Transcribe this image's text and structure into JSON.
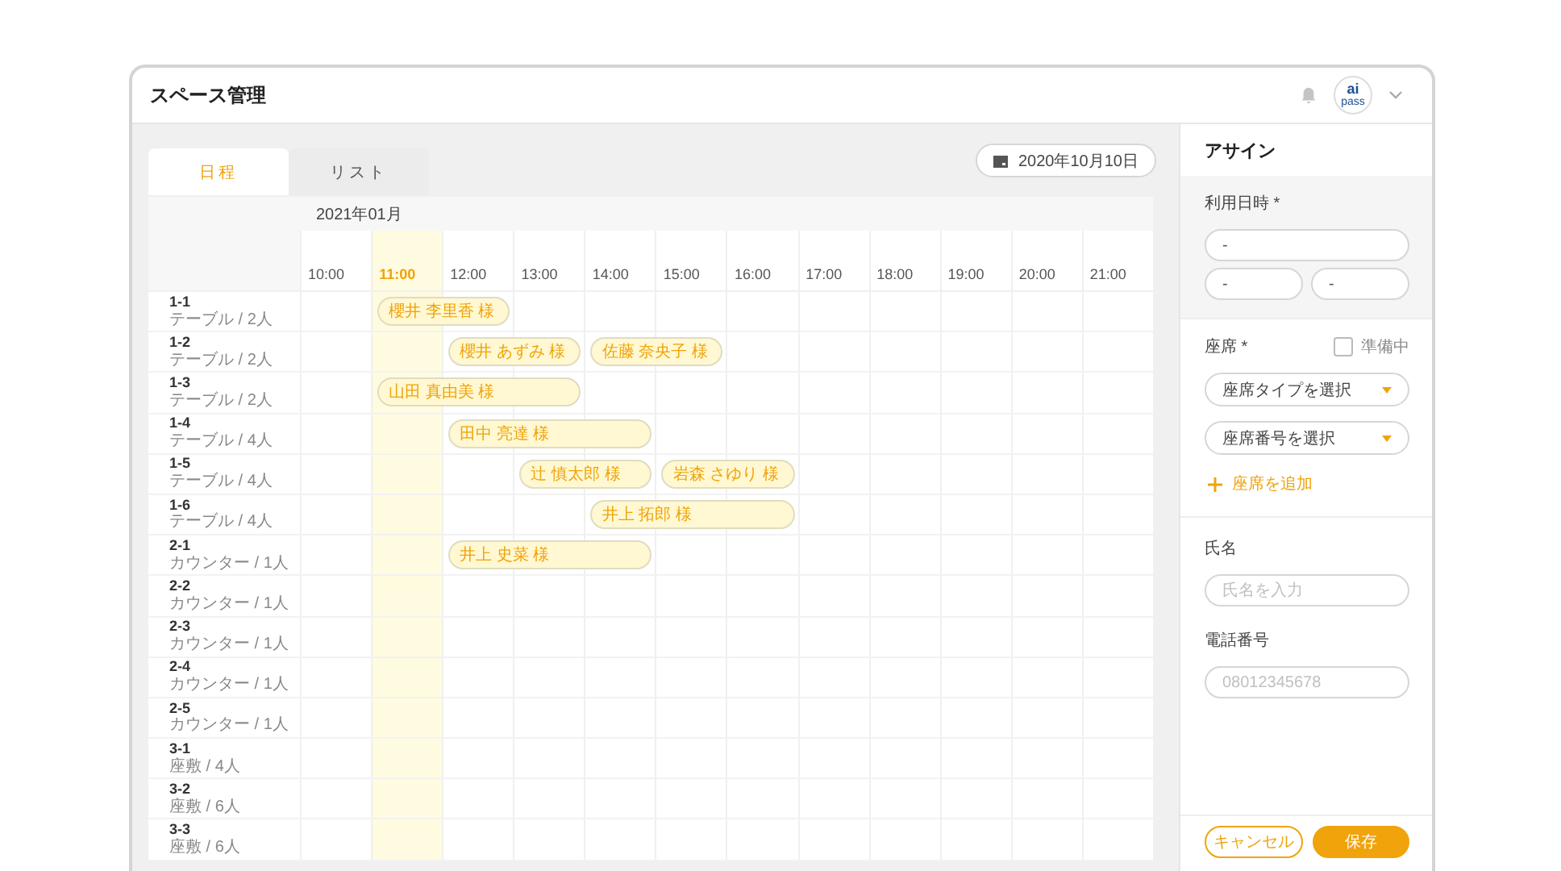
{
  "header": {
    "title": "スペース管理",
    "logo": {
      "text": "ai",
      "subtext": "pass"
    }
  },
  "tabs": [
    {
      "label": "日程",
      "selected": true
    },
    {
      "label": "リスト",
      "selected": false
    }
  ],
  "date_button": "2020年10月10日",
  "schedule": {
    "month": "2021年01月",
    "hours": [
      {
        "label": "10:00",
        "selected": false
      },
      {
        "label": "11:00",
        "selected": true
      },
      {
        "label": "12:00",
        "selected": false
      },
      {
        "label": "13:00",
        "selected": false
      },
      {
        "label": "14:00",
        "selected": false
      },
      {
        "label": "15:00",
        "selected": false
      },
      {
        "label": "16:00",
        "selected": false
      },
      {
        "label": "17:00",
        "selected": false
      },
      {
        "label": "18:00",
        "selected": false
      },
      {
        "label": "19:00",
        "selected": false
      },
      {
        "label": "20:00",
        "selected": false
      },
      {
        "label": "21:00",
        "selected": false
      }
    ],
    "rows": [
      {
        "seat": "1-1",
        "detail": "テーブル / 2人",
        "slots": [
          {
            "kind": "free"
          },
          {
            "kind": "start",
            "name": "櫻井 李里香 様"
          },
          {
            "kind": "continue"
          }
        ]
      },
      {
        "seat": "1-2",
        "detail": "テーブル / 2人",
        "slots": [
          {
            "kind": "free"
          },
          {
            "kind": "free"
          },
          {
            "kind": "start",
            "name": "櫻井 あずみ 様"
          },
          {
            "kind": "continue"
          },
          {
            "kind": "start",
            "name": "佐藤 奈央子 様"
          },
          {
            "kind": "continue"
          }
        ]
      },
      {
        "seat": "1-3",
        "detail": "テーブル / 2人",
        "slots": [
          {
            "kind": "free"
          },
          {
            "kind": "start",
            "name": "山田 真由美 様"
          },
          {
            "kind": "continue"
          },
          {
            "kind": "continue"
          }
        ]
      },
      {
        "seat": "1-4",
        "detail": "テーブル / 4人",
        "slots": [
          {
            "kind": "free"
          },
          {
            "kind": "free"
          },
          {
            "kind": "start",
            "name": "田中 亮達 様"
          },
          {
            "kind": "continue"
          },
          {
            "kind": "continue"
          }
        ]
      },
      {
        "seat": "1-5",
        "detail": "テーブル / 4人",
        "slots": [
          {
            "kind": "free"
          },
          {
            "kind": "free"
          },
          {
            "kind": "free"
          },
          {
            "kind": "start",
            "name": "辻 慎太郎 様"
          },
          {
            "kind": "continue"
          },
          {
            "kind": "start",
            "name": "岩森 さゆり 様"
          },
          {
            "kind": "continue"
          }
        ]
      },
      {
        "seat": "1-6",
        "detail": "テーブル / 4人",
        "slots": [
          {
            "kind": "free"
          },
          {
            "kind": "free"
          },
          {
            "kind": "free"
          },
          {
            "kind": "free"
          },
          {
            "kind": "start",
            "name": "井上 拓郎 様"
          },
          {
            "kind": "continue"
          },
          {
            "kind": "continue"
          }
        ]
      },
      {
        "seat": "2-1",
        "detail": "カウンター / 1人",
        "slots": [
          {
            "kind": "free"
          },
          {
            "kind": "free"
          },
          {
            "kind": "start",
            "name": "井上 史菜 様"
          },
          {
            "kind": "continue"
          },
          {
            "kind": "continue"
          }
        ]
      },
      {
        "seat": "2-2",
        "detail": "カウンター / 1人"
      },
      {
        "seat": "2-3",
        "detail": "カウンター / 1人"
      },
      {
        "seat": "2-4",
        "detail": "カウンター / 1人"
      },
      {
        "seat": "2-5",
        "detail": "カウンター / 1人"
      },
      {
        "seat": "3-1",
        "detail": "座敷 / 4人"
      },
      {
        "seat": "3-2",
        "detail": "座敷 / 6人"
      },
      {
        "seat": "3-3",
        "detail": "座敷 / 6人"
      }
    ]
  },
  "assign_panel": {
    "title": "アサイン",
    "datetime": {
      "label": "利用日時 *",
      "date_value": "-",
      "start_value": "-",
      "end_value": "-"
    },
    "seat": {
      "label": "座席 *",
      "preparing": {
        "label": "準備中",
        "checked": false
      },
      "type_select": "座席タイプを選択",
      "number_select": "座席番号を選択",
      "add_button": "座席を追加"
    },
    "name": {
      "label": "氏名",
      "placeholder": "氏名を入力"
    },
    "phone": {
      "label": "電話番号",
      "placeholder": "08012345678"
    },
    "buttons": {
      "cancel": "キャンセル",
      "save": "保存"
    }
  }
}
